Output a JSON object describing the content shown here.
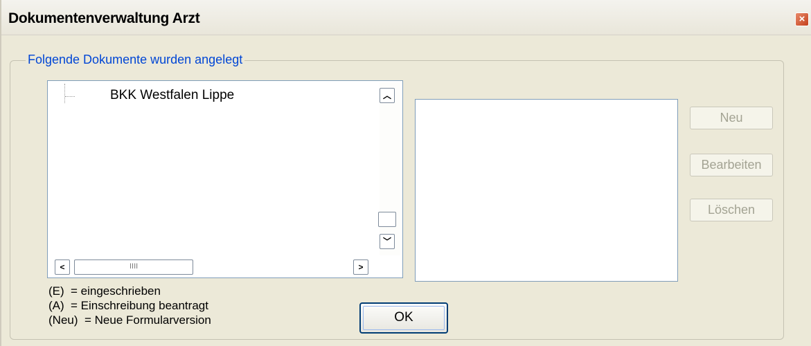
{
  "window": {
    "title": "Dokumentenverwaltung Arzt",
    "close_icon": "close-icon"
  },
  "group": {
    "legend": "Folgende Dokumente wurden angelegt"
  },
  "tree": {
    "items": [
      {
        "label": "BKK Westfalen Lippe"
      }
    ]
  },
  "scrollbar": {
    "up": "^",
    "down": "v",
    "left": "<",
    "right": ">",
    "grip": "IIII"
  },
  "buttons": {
    "new": "Neu",
    "edit": "Bearbeiten",
    "delete": "Löschen",
    "ok": "OK"
  },
  "legend": [
    {
      "key": "(E)",
      "text": "= eingeschrieben"
    },
    {
      "key": "(A)",
      "text": "= Einschreibung beantragt"
    },
    {
      "key": "(Neu)",
      "text": "= Neue Formularversion"
    }
  ],
  "colors": {
    "group_legend": "#0046d5",
    "window_bg": "#ece9d8",
    "close_button": "#c4401c"
  }
}
